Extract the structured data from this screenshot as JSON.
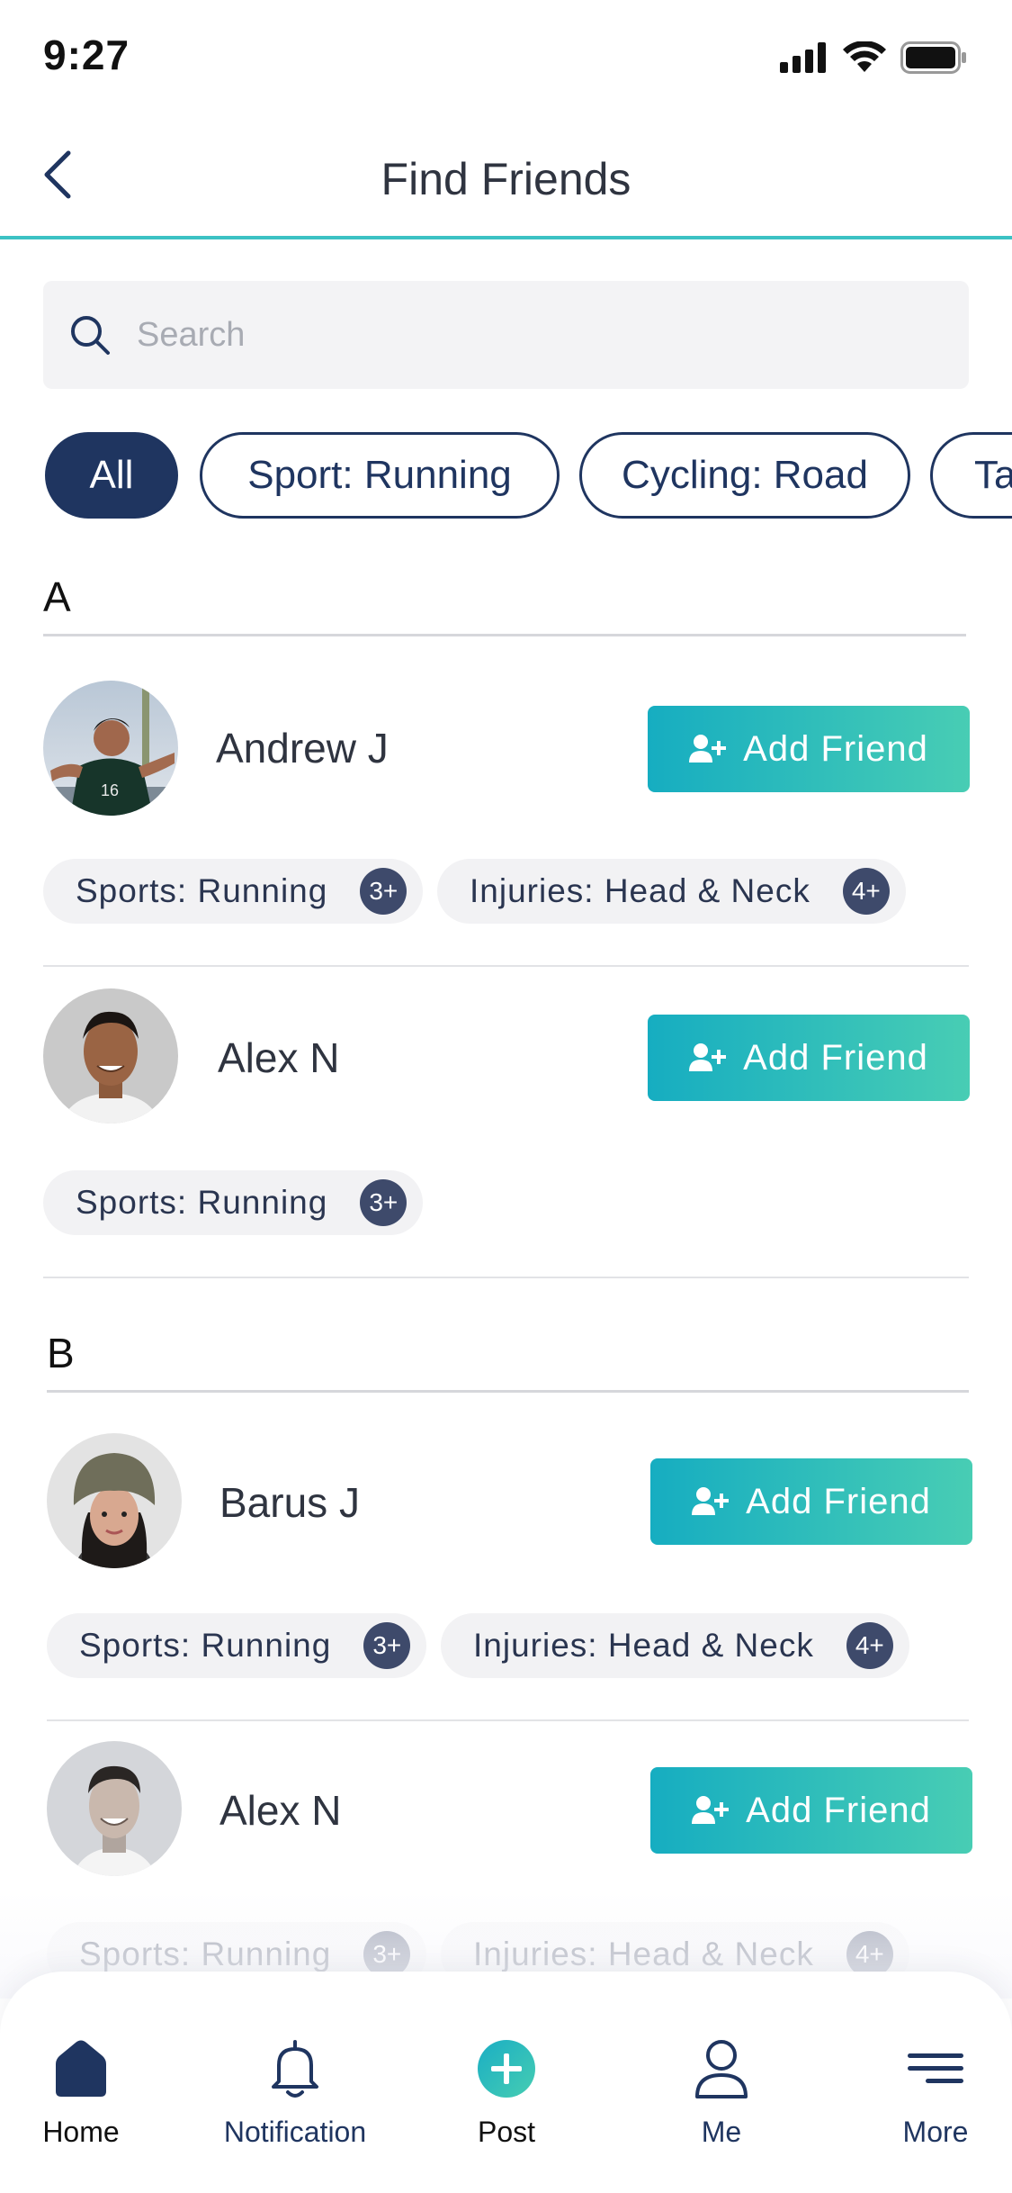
{
  "status_bar": {
    "time": "9:27"
  },
  "header": {
    "title": "Find Friends"
  },
  "search": {
    "placeholder": "Search"
  },
  "filters": [
    {
      "label": "All",
      "active": true
    },
    {
      "label": "Sport: Running",
      "active": false
    },
    {
      "label": "Cycling: Road",
      "active": false
    },
    {
      "label": "Ta",
      "active": false
    }
  ],
  "sections": [
    {
      "letter": "A",
      "friends": [
        {
          "name": "Andrew J",
          "button": "Add Friend",
          "tags": [
            {
              "label": "Sports: Running",
              "count": "3+"
            },
            {
              "label": "Injuries: Head & Neck",
              "count": "4+"
            }
          ]
        },
        {
          "name": "Alex N",
          "button": "Add Friend",
          "tags": [
            {
              "label": "Sports: Running",
              "count": "3+"
            }
          ]
        }
      ]
    },
    {
      "letter": "B",
      "friends": [
        {
          "name": "Barus J",
          "button": "Add Friend",
          "tags": [
            {
              "label": "Sports: Running",
              "count": "3+"
            },
            {
              "label": "Injuries: Head & Neck",
              "count": "4+"
            }
          ]
        },
        {
          "name": "Alex N",
          "button": "Add Friend",
          "tags": [
            {
              "label": "Sports: Running",
              "count": "3+"
            },
            {
              "label": "Injuries: Head & Neck",
              "count": "4+"
            }
          ]
        }
      ]
    }
  ],
  "tabbar": {
    "items": [
      {
        "label": "Home",
        "icon": "home-icon",
        "active": true
      },
      {
        "label": "Notification",
        "icon": "bell-icon",
        "active": false
      },
      {
        "label": "Post",
        "icon": "plus-circle-icon",
        "active": false
      },
      {
        "label": "Me",
        "icon": "person-icon",
        "active": false
      },
      {
        "label": "More",
        "icon": "menu-icon",
        "active": false
      }
    ]
  },
  "colors": {
    "navy": "#1f3560",
    "teal_start": "#16adc1",
    "teal_end": "#48cdb4",
    "header_line": "#3cc2c4",
    "post_accent": "#2fbfb3"
  }
}
